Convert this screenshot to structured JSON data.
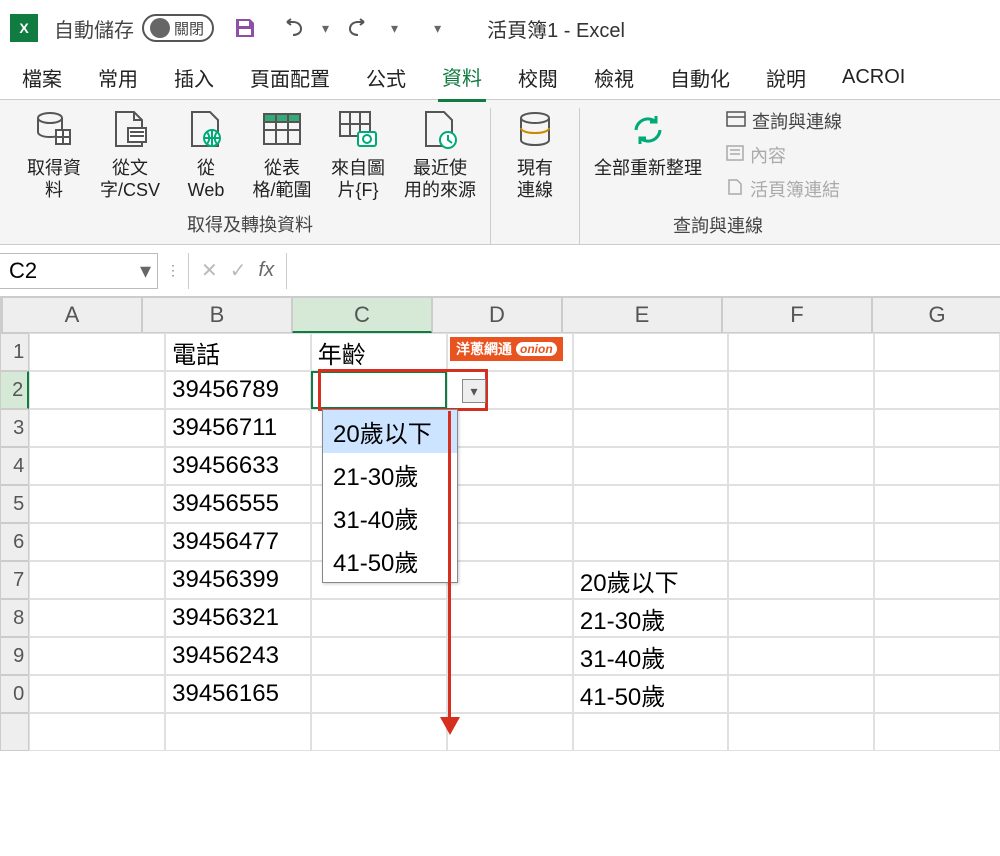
{
  "titlebar": {
    "autosave_label": "自動儲存",
    "toggle_state": "關閉",
    "doc_title": "活頁簿1 - Excel"
  },
  "tabs": {
    "file": "檔案",
    "home": "常用",
    "insert": "插入",
    "layout": "頁面配置",
    "formulas": "公式",
    "data": "資料",
    "review": "校閱",
    "view": "檢視",
    "automate": "自動化",
    "help": "說明",
    "acrobat": "ACROI"
  },
  "ribbon": {
    "get_data": "取得資\n料",
    "from_text": "從文\n字/CSV",
    "from_web": "從\nWeb",
    "from_table": "從表\n格/範圍",
    "from_pic": "來自圖\n片{F}",
    "recent": "最近使\n用的來源",
    "existing": "現有\n連線",
    "refresh_all": "全部重新整理",
    "queries": "查詢與連線",
    "properties": "內容",
    "links": "活頁簿連結",
    "group1_label": "取得及轉換資料",
    "group2_label": "查詢與連線"
  },
  "namebox": {
    "value": "C2"
  },
  "headers": {
    "cols": [
      "A",
      "B",
      "C",
      "D",
      "E",
      "F",
      "G"
    ],
    "rows": [
      "1",
      "2",
      "3",
      "4",
      "5",
      "6",
      "7",
      "8",
      "9",
      "0"
    ]
  },
  "cells": {
    "B1": "電話",
    "C1": "年齡",
    "B2": "39456789",
    "B3": "39456711",
    "B4": "39456633",
    "B5": "39456555",
    "B6": "39456477",
    "B7": "39456399",
    "B8": "39456321",
    "B9": "39456243",
    "B10": "39456165",
    "E7": "20歲以下",
    "E8": "21-30歲",
    "E9": "31-40歲",
    "E10": "41-50歲"
  },
  "dropdown": {
    "items": [
      "20歲以下",
      "21-30歲",
      "31-40歲",
      "41-50歲"
    ]
  },
  "watermark": {
    "text": "洋蔥網通",
    "logo": "onion"
  }
}
